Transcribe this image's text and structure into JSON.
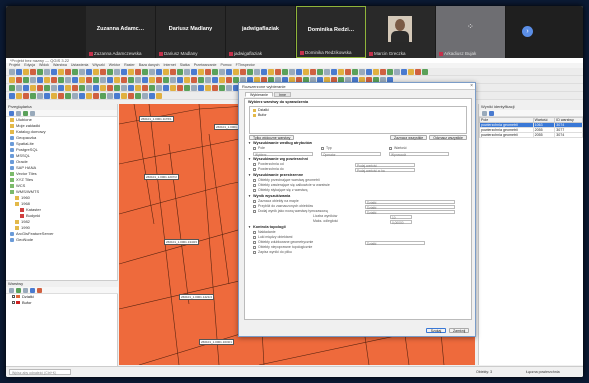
{
  "meeting": {
    "participants": [
      {
        "name": "Zuzanna Adamc…",
        "caption": "Zuzanna Adamczewska",
        "type": "name"
      },
      {
        "name": "Dariusz Madlany",
        "caption": "Dariusz Madlany",
        "type": "name"
      },
      {
        "name": "jadwigaflaziak",
        "caption": "jadwigaflaziak",
        "type": "name"
      },
      {
        "name": "Dominika Redzi…",
        "caption": "Dominika Redzikowska",
        "type": "name",
        "active": true
      },
      {
        "name": "",
        "caption": "Marcin Greczka",
        "type": "camera"
      },
      {
        "name": "",
        "caption": "Arkadiusz Bujak",
        "type": "more"
      }
    ],
    "more_label": "›"
  },
  "qgis": {
    "title": "*Projekt bez nazwy — QGIS 3.22",
    "menu": [
      "Projekt",
      "Edycja",
      "Widok",
      "Warstwa",
      "Ustawienia",
      "Wtyczki",
      "Wektor",
      "Raster",
      "Baza danych",
      "Internet",
      "Siatka",
      "Przetwarzanie",
      "Pomoc",
      "FTInspector"
    ],
    "browser": {
      "title": "Przeglądarka",
      "items": [
        {
          "label": "Ulubione",
          "icon": "star",
          "indent": 0
        },
        {
          "label": "Moje zakładki",
          "icon": "folder",
          "indent": 0
        },
        {
          "label": "Katalog domowy",
          "icon": "folder",
          "indent": 0
        },
        {
          "label": "Geopaczka",
          "icon": "db",
          "indent": 0
        },
        {
          "label": "SpatiaLite",
          "icon": "db",
          "indent": 0
        },
        {
          "label": "PostgreSQL",
          "icon": "db",
          "indent": 0
        },
        {
          "label": "MSSQL",
          "icon": "db",
          "indent": 0
        },
        {
          "label": "Oracle",
          "icon": "db",
          "indent": 0
        },
        {
          "label": "SAP HANA",
          "icon": "db",
          "indent": 0
        },
        {
          "label": "Vector Tiles",
          "icon": "grid",
          "indent": 0
        },
        {
          "label": "XYZ Tiles",
          "icon": "grid",
          "indent": 0
        },
        {
          "label": "WCS",
          "icon": "grid",
          "indent": 0
        },
        {
          "label": "WMS/WMTS",
          "icon": "grid",
          "indent": 0
        },
        {
          "label": "1960",
          "icon": "folder",
          "indent": 1
        },
        {
          "label": "1968",
          "icon": "folder",
          "indent": 1
        },
        {
          "label": "Kataster",
          "icon": "sel",
          "indent": 2
        },
        {
          "label": "Budynki",
          "icon": "sel",
          "indent": 2
        },
        {
          "label": "1982",
          "icon": "folder",
          "indent": 1
        },
        {
          "label": "1990",
          "icon": "folder",
          "indent": 1
        },
        {
          "label": "ArcGisFeatureServer",
          "icon": "db",
          "indent": 0
        },
        {
          "label": "GeoNode",
          "icon": "db",
          "indent": 0
        }
      ]
    },
    "layers": {
      "title": "Warstwy",
      "items": [
        {
          "label": "Działki",
          "color": "#e0683a"
        },
        {
          "label": "Bufor",
          "color": "#cc2222"
        }
      ]
    },
    "map_labels": [
      "260101_1.0001.1176/1",
      "260101_1.0001.1178/2",
      "260101_1.0001.1190",
      "260101_1.0001.1207/2",
      "260101_1.0001.1306/1",
      "260101_1.0001.1311",
      "260101_1.0001.1340/3",
      "260101_1.0001.1398",
      "260101_1.0001.1421/4",
      "260101_1.0001.1502",
      "260101_1.0001.1633/1",
      "260101_1.0001.1716"
    ],
    "results": {
      "title": "Wyniki identyfikacji",
      "headers": [
        "Pole",
        "Wartość",
        "ID warstwy"
      ],
      "rows": [
        {
          "cells": [
            "powierzchnia geometrii",
            "1063",
            "3074"
          ],
          "selected": true
        },
        {
          "cells": [
            "powierzchnia geometrii",
            "2055",
            "3077"
          ],
          "selected": false
        },
        {
          "cells": [
            "powierzchnia geometrii",
            "2055",
            "3074"
          ],
          "selected": false
        }
      ]
    },
    "status": {
      "search_placeholder": "Wpisz aby odnaleźć (Ctrl+K)",
      "coord": "Współrzędne 598471,244970,7",
      "scale": "Skala 1:2000",
      "magnifier": "Lupa 100%",
      "rotation": "Obrót 0,0 °",
      "render": "Renderuj",
      "epsg": "EPSG:2180",
      "feature_total": "Obiekty: 3",
      "total_area": "Łączna powierzchnia"
    }
  },
  "dialog": {
    "title": "Rozszerzone wybieranie",
    "tabs": [
      "Wybieranie",
      "Inne"
    ],
    "section_layers": "Wybierz warstwy do sprawdzenia",
    "layer_list": [
      "Działki",
      "Bufor"
    ],
    "btn_select_visible": "Tylko widoczne warstwy",
    "btn_select_all": "Zaznacz wszystkie",
    "btn_deselect_all": "Odznacz wszystkie",
    "section_attr": "Wyszukiwanie według atrybutów",
    "attr_fields": [
      "Pole",
      "Typ",
      "Wartość"
    ],
    "attr_inputs": [
      "Wybierz",
      "Operator",
      "Wprowadź"
    ],
    "section_area": "Wyszukiwanie wg powierzchni",
    "area_rows": [
      "Powierzchnia od",
      "Powierzchnia do"
    ],
    "area_inputs": [
      "Podaj wartość",
      "Podaj wartość w ha"
    ],
    "section_buffer": "Wyszukiwanie przestrzenne",
    "buffer_rows": [
      "Obiekty przecinające warstwę geometrii",
      "Obiekty zawierające się całkowicie w warstwie",
      "Obiekty stykające się z warstwą"
    ],
    "section_selection": "Wynik wyszukiwania",
    "selection_rows": [
      "Zaznacz obiekty na mapie",
      "Przybliż do zaznaczonych obiektów",
      "Dodaj wynik jako nową warstwę tymczasową"
    ],
    "selection_inputs": [
      "Działki",
      "Działki",
      "Działki"
    ],
    "spin_label": "Liczba wyników",
    "spin_value": "10",
    "threshold_label": "Maks. odległość",
    "threshold_value": "0,00000",
    "section_topology": "Kontrola topologii",
    "topo_rows": [
      "Nakładanie",
      "Luki między obiektami",
      "Obiekty zdublowane geometrycznie",
      "Obiekty niepoprawne topologicznie",
      "Zapisz wyniki do pliku"
    ],
    "topo_input": "Działki",
    "ok": "Szukaj",
    "cancel": "Zamknij"
  }
}
